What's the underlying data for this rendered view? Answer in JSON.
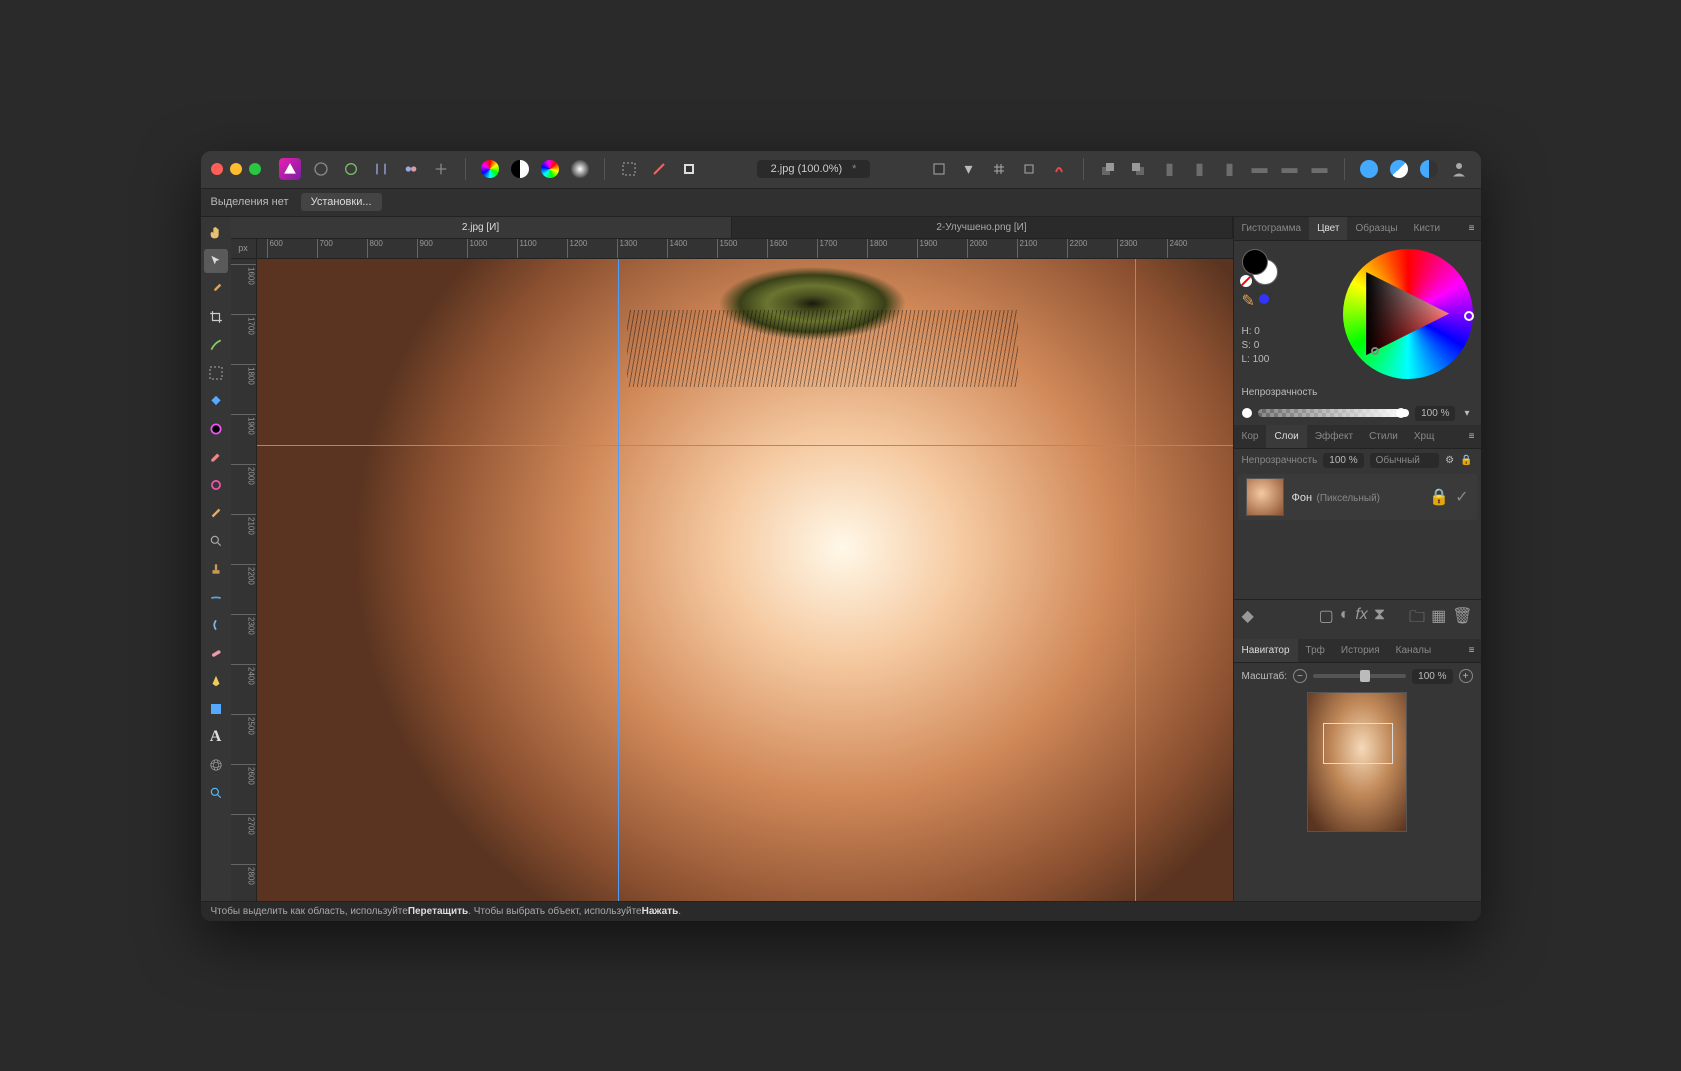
{
  "titlebar": {
    "doc_title": "2.jpg (100.0%)",
    "modified": "*"
  },
  "contextbar": {
    "no_selection": "Выделения нет",
    "presets_btn": "Установки..."
  },
  "doc_tabs": [
    {
      "label": "2.jpg [И]",
      "active": true
    },
    {
      "label": "2-Улучшено.png [И]",
      "active": false
    }
  ],
  "ruler_unit": "px",
  "ruler_h_ticks": [
    "600",
    "700",
    "800",
    "900",
    "1000",
    "1100",
    "1200",
    "1300",
    "1400",
    "1500",
    "1600",
    "1700",
    "1800",
    "1900",
    "2000",
    "2100",
    "2200",
    "2300",
    "2400"
  ],
  "ruler_v_ticks": [
    "1600",
    "1700",
    "1800",
    "1900",
    "2000",
    "2100",
    "2200",
    "2300",
    "2400",
    "2500",
    "2600",
    "2700",
    "2800"
  ],
  "panels": {
    "top_tabs": [
      "Гистограмма",
      "Цвет",
      "Образцы",
      "Кисти"
    ],
    "top_active": "Цвет",
    "hsl": {
      "h": "H: 0",
      "s": "S: 0",
      "l": "L: 100"
    },
    "opacity_label": "Непрозрачность",
    "opacity_value": "100 %",
    "mid_tabs": [
      "Кор",
      "Слои",
      "Эффект",
      "Стили",
      "Хрщ"
    ],
    "mid_active": "Слои",
    "layer_opacity_label": "Непрозрачность",
    "layer_opacity_value": "100 %",
    "blend_mode": "Обычный",
    "layer": {
      "name": "Фон",
      "type": "(Пиксельный)"
    },
    "bottom_tabs": [
      "Навигатор",
      "Трф",
      "История",
      "Каналы"
    ],
    "bottom_active": "Навигатор",
    "zoom_label": "Масштаб:",
    "zoom_value": "100 %"
  },
  "statusbar": {
    "prefix": "Чтобы выделить как область, используйте ",
    "bold1": "Перетащить",
    "mid": ". Чтобы выбрать объект, используйте ",
    "bold2": "Нажать",
    "suffix": "."
  }
}
